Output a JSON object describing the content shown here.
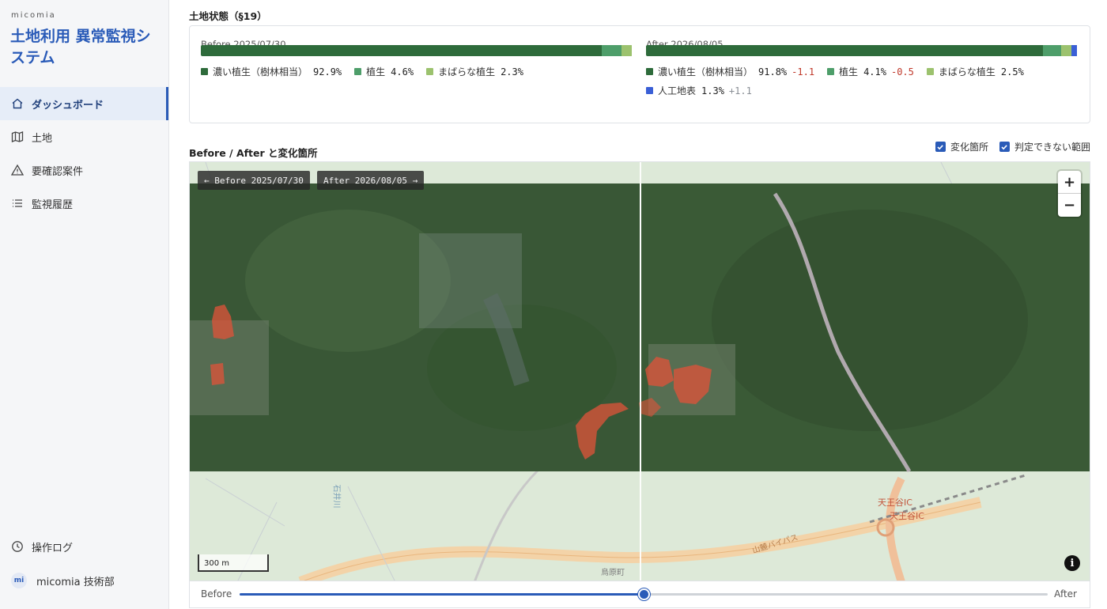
{
  "sidebar": {
    "brand_small": "micomia",
    "brand_title": "土地利用 異常監視システム",
    "items": [
      {
        "label": "ダッシュボード",
        "icon": "home-icon",
        "active": true
      },
      {
        "label": "土地",
        "icon": "map-icon",
        "active": false
      },
      {
        "label": "要確認案件",
        "icon": "warning-icon",
        "active": false
      },
      {
        "label": "監視履歴",
        "icon": "list-icon",
        "active": false
      }
    ],
    "log_label": "操作ログ",
    "user": {
      "initials": "mi",
      "name": "micomia 技術部"
    }
  },
  "land_state": {
    "title": "土地状態（§19）",
    "before": {
      "date_label": "Before 2025/07/30",
      "segments": [
        {
          "name": "濃い植生（樹林相当）",
          "pct_text": "92.9%",
          "value": 92.9,
          "color": "#2e6b3b"
        },
        {
          "name": "植生",
          "pct_text": "4.6%",
          "value": 4.6,
          "color": "#4e9e6a"
        },
        {
          "name": "まばらな植生",
          "pct_text": "2.3%",
          "value": 2.3,
          "color": "#9cc26e"
        }
      ]
    },
    "after": {
      "date_label": "After 2026/08/05",
      "segments": [
        {
          "name": "濃い植生（樹林相当）",
          "pct_text": "91.8%",
          "delta": "-1.1",
          "value": 91.8,
          "color": "#2e6b3b"
        },
        {
          "name": "植生",
          "pct_text": "4.1%",
          "delta": "-0.5",
          "value": 4.1,
          "color": "#4e9e6a"
        },
        {
          "name": "まばらな植生",
          "pct_text": "2.5%",
          "delta": "",
          "value": 2.5,
          "color": "#9cc26e"
        },
        {
          "name": "人工地表",
          "pct_text": "1.3%",
          "delta": "+1.1",
          "value": 1.3,
          "color": "#3a5fd6"
        }
      ]
    }
  },
  "compare": {
    "title": "Before / After と変化箇所",
    "toggle_changes": "変化箇所",
    "toggle_undetermined": "判定できない範囲",
    "before_chip": "← Before 2025/07/30",
    "after_chip": "After 2026/08/05 →",
    "zoom_in": "+",
    "zoom_out": "−",
    "scale_label": "300 m",
    "info": "i",
    "map_labels": {
      "ic1": "天王谷IC",
      "ic2": "天王谷IC",
      "road": "山麓バイパス",
      "town": "烏原町",
      "river": "石井川"
    }
  },
  "slider": {
    "left_label": "Before",
    "right_label": "After",
    "position": 0.5
  },
  "colors": {
    "accent": "#2a5bb8",
    "change": "#e0533a"
  }
}
